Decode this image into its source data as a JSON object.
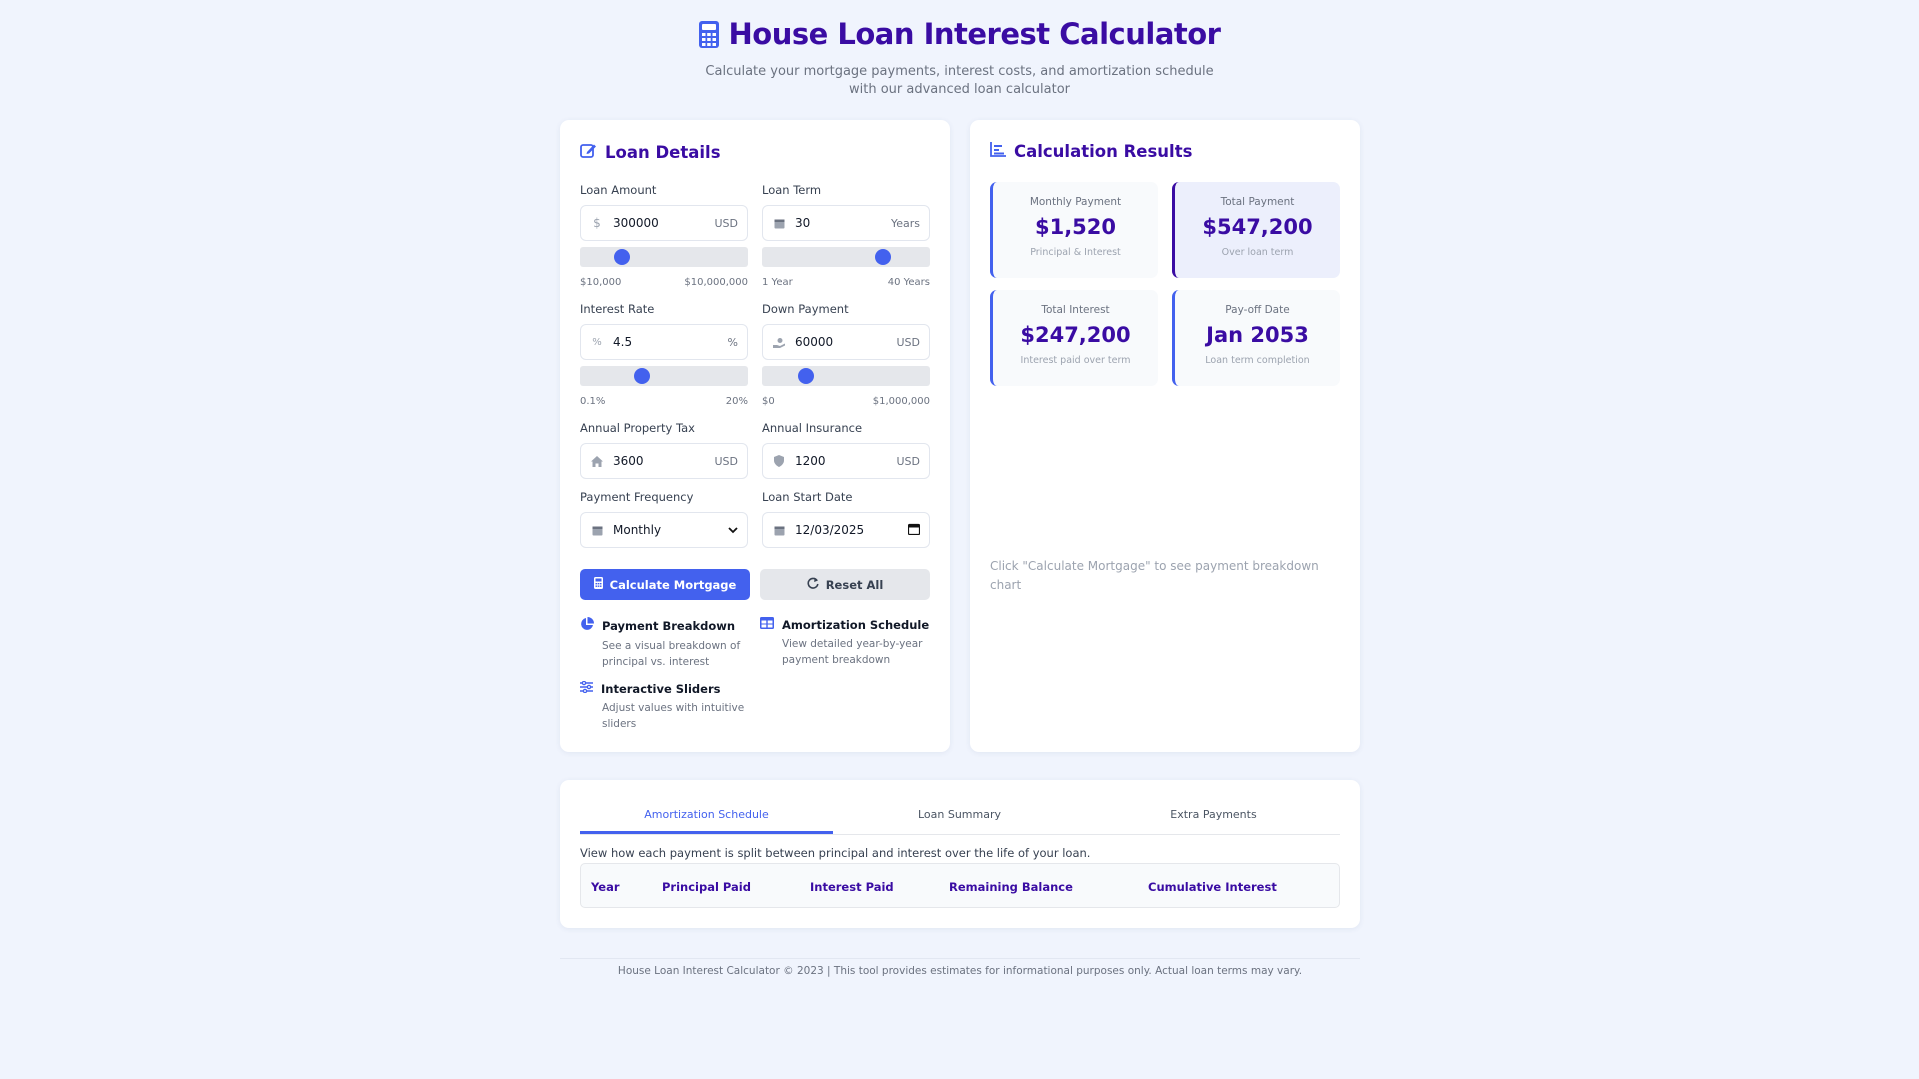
{
  "header": {
    "title": "House Loan Interest Calculator",
    "subtitle_line1": "Calculate your mortgage payments, interest costs, and amortization schedule",
    "subtitle_line2": "with our advanced loan calculator"
  },
  "loan_details": {
    "heading": "Loan Details",
    "loan_amount": {
      "label": "Loan Amount",
      "value": "300000",
      "unit": "USD",
      "min": "$10,000",
      "max": "$10,000,000",
      "slider_position": 0.25
    },
    "loan_term": {
      "label": "Loan Term",
      "value": "30",
      "unit": "Years",
      "min": "1 Year",
      "max": "40 Years",
      "slider_position": 0.72
    },
    "interest_rate": {
      "label": "Interest Rate",
      "value": "4.5",
      "unit": "%",
      "min": "0.1%",
      "max": "20%",
      "slider_position": 0.37
    },
    "down_payment": {
      "label": "Down Payment",
      "value": "60000",
      "unit": "USD",
      "min": "$0",
      "max": "$1,000,000",
      "slider_position": 0.26
    },
    "property_tax": {
      "label": "Annual Property Tax",
      "value": "3600",
      "unit": "USD"
    },
    "insurance": {
      "label": "Annual Insurance",
      "value": "1200",
      "unit": "USD"
    },
    "frequency": {
      "label": "Payment Frequency",
      "value": "Monthly"
    },
    "start_date": {
      "label": "Loan Start Date",
      "value": "12/03/2025"
    },
    "calculate_label": "Calculate Mortgage",
    "reset_label": "Reset All",
    "features": [
      {
        "title": "Payment Breakdown",
        "desc1": "See a visual breakdown of",
        "desc2": "principal vs. interest"
      },
      {
        "title": "Amortization Schedule",
        "desc1": "View detailed year-by-year",
        "desc2": "payment breakdown"
      },
      {
        "title": "Interactive Sliders",
        "desc1": "Adjust values with intuitive",
        "desc2": "sliders"
      }
    ]
  },
  "results": {
    "heading": "Calculation Results",
    "monthly": {
      "label": "Monthly Payment",
      "value": "$1,520",
      "sub": "Principal & Interest"
    },
    "total_payment": {
      "label": "Total Payment",
      "value": "$547,200",
      "sub": "Over loan term"
    },
    "total_interest": {
      "label": "Total Interest",
      "value": "$247,200",
      "sub": "Interest paid over term"
    },
    "payoff": {
      "label": "Pay-off Date",
      "value": "Jan 2053",
      "sub": "Loan term completion"
    },
    "chart_placeholder_line1": "Click \"Calculate Mortgage\" to see payment breakdown",
    "chart_placeholder_line2": "chart"
  },
  "schedule": {
    "tabs": [
      "Amortization Schedule",
      "Loan Summary",
      "Extra Payments"
    ],
    "active_tab": 0,
    "description": "View how each payment is split between principal and interest over the life of your loan.",
    "columns": [
      "Year",
      "Principal Paid",
      "Interest Paid",
      "Remaining Balance",
      "Cumulative Interest"
    ]
  },
  "footer": {
    "text": "House Loan Interest Calculator © 2023 | This tool provides estimates for informational purposes only. Actual loan terms may vary."
  },
  "colors": {
    "primary": "#4361ee",
    "heading": "#3a0ca3",
    "background": "#f0f4fd"
  }
}
